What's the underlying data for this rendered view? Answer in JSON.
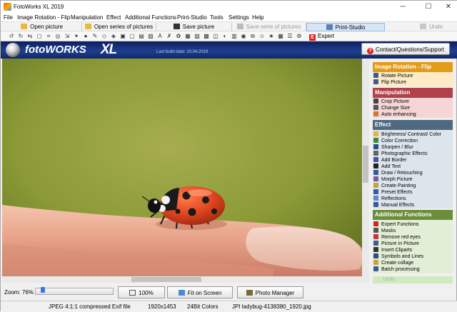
{
  "window": {
    "title": "FotoWorks XL 2019",
    "controls": [
      "─",
      "☐",
      "✕"
    ]
  },
  "menu": [
    "File",
    "Image Rotation - Flip",
    "Manipulation",
    "Effect",
    "Additional Functions",
    "Print-Studio",
    "Tools",
    "Settings",
    "Help"
  ],
  "actionbar": {
    "open_picture": "Open picture",
    "open_series": "Open series of pictures",
    "save_picture": "Save picture",
    "save_series": "Save serie of pictures",
    "print_studio": "Print-Studio",
    "undo": "Undo"
  },
  "iconbar": {
    "expert_functions": "Expert Functions",
    "expert_badge": "E"
  },
  "banner": {
    "logo": "fotoWORKS",
    "logo_xl": "XL",
    "build_date": "Last build date: 10.04.2019",
    "contact": "Contact/Questions/Support",
    "contact_icon": "?"
  },
  "bottom": {
    "zoom": "Zoom: 76%",
    "zoom_fraction": 0.1,
    "btn_100": "100%",
    "btn_fit": "Fit on Screen",
    "btn_manager": "Photo Manager"
  },
  "status": {
    "format": "JPEG 4:1:1 compressed Exif file",
    "size": "1920x1453",
    "colors": "24Bit Colors",
    "file": "JPI ladybug-4138380_1920.jpg"
  },
  "panel": {
    "rotation": {
      "title": "Image Rotation - Flip",
      "color": "#e39b1a",
      "bg": "#fdebc6",
      "items": [
        "Rotate Picture",
        "Flip Picture"
      ]
    },
    "manipulation": {
      "title": "Manipulation",
      "color": "#b0404a",
      "bg": "#f5d5d6",
      "items": [
        "Crop Picture",
        "Change Size",
        "Auto enhancing"
      ]
    },
    "effect": {
      "title": "Effect",
      "color": "#4f6a80",
      "bg": "#dce4ec",
      "items": [
        "Brightness/ Contrast/ Color",
        "Color Correction",
        "Sharpen / Blur",
        "Photographic Effects",
        "Add Border",
        "Add Text",
        "Draw / Retouching",
        "Morph Picture",
        "Create Painting",
        "Preset Effects",
        "Reflections",
        "Manual Effects"
      ]
    },
    "additional": {
      "title": "Additional Functions",
      "color": "#6b8e3a",
      "bg": "#e2eed6",
      "items": [
        "Expert Functions",
        "Masks",
        "Remove red eyes",
        "Picture in Picture",
        "Insert Cliparts",
        "Symbols and Lines",
        "Create collage",
        "Batch processing"
      ]
    },
    "undo": "Undo"
  }
}
